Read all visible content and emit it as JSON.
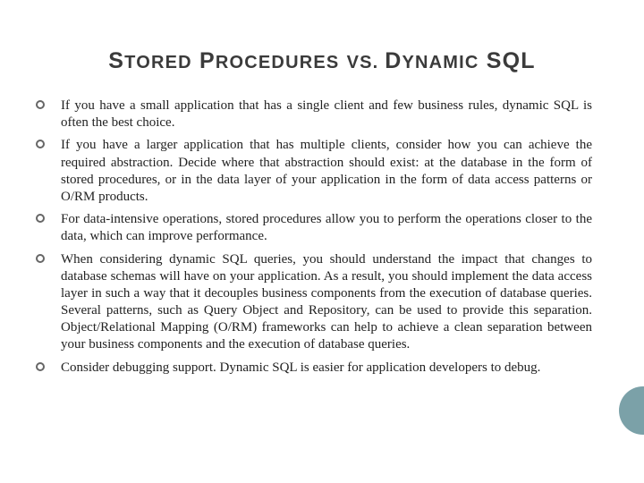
{
  "title": {
    "w1_first": "S",
    "w1_rest": "TORED",
    "w2_first": "P",
    "w2_rest": "ROCEDURES",
    "mid": " VS. ",
    "w3_first": "D",
    "w3_rest": "YNAMIC",
    "w4": " SQL"
  },
  "bullets": [
    "If you have a small application that has a single client and few business rules, dynamic SQL is often the best choice.",
    "If you have a larger application that has multiple clients, consider how you can achieve the required abstraction. Decide where that abstraction should exist: at the database in the form of stored procedures, or in the data layer of your application in the form of data access patterns or O/RM products.",
    "For data-intensive operations, stored procedures allow you to perform the operations closer to the data, which can improve performance.",
    "When considering dynamic SQL queries, you should understand the impact that changes to database schemas will have on your application. As a result, you should implement the data access layer in such a way that it decouples business components from the execution of database queries. Several patterns, such as Query Object and Repository, can be used to provide this separation. Object/Relational Mapping (O/RM) frameworks can help to achieve a clean separation between your business components and the execution of database queries.",
    "Consider debugging support. Dynamic SQL is easier for application developers to debug."
  ]
}
